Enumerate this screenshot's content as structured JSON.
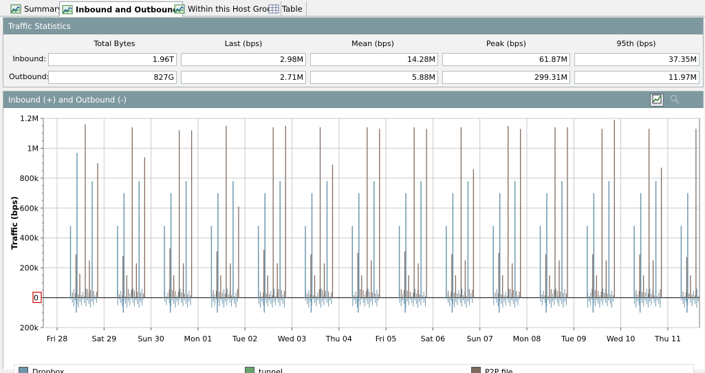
{
  "tabs": [
    {
      "label": "Summary",
      "active": false,
      "icon": "chart-icon"
    },
    {
      "label": "Inbound and Outbound",
      "active": true,
      "icon": "chart-icon"
    },
    {
      "label": "Within this Host Group",
      "active": false,
      "icon": "chart-icon"
    },
    {
      "label": "Table",
      "active": false,
      "icon": "table-icon"
    }
  ],
  "stats": {
    "title": "Traffic Statistics",
    "columns": [
      "Total Bytes",
      "Last (bps)",
      "Mean (bps)",
      "Peak (bps)",
      "95th (bps)"
    ],
    "rows": [
      {
        "label": "Inbound:",
        "values": [
          "1.96T",
          "2.98M",
          "14.28M",
          "61.87M",
          "37.35M"
        ]
      },
      {
        "label": "Outbound:",
        "values": [
          "827G",
          "2.71M",
          "5.88M",
          "299.31M",
          "11.97M"
        ]
      }
    ]
  },
  "chart_panel": {
    "title": "Inbound (+) and Outbound (-)",
    "buttons": [
      "chart-options-icon",
      "zoom-icon"
    ]
  },
  "chart_data": {
    "type": "bar",
    "ylabel": "Traffic (bps)",
    "ylim": [
      -200000,
      1200000
    ],
    "yticks": [
      "1.2M",
      "1M",
      "800k",
      "600k",
      "400k",
      "200k",
      "0",
      "200k"
    ],
    "yticks_values": [
      1200000,
      1000000,
      800000,
      600000,
      400000,
      200000,
      0,
      -200000
    ],
    "xticks": [
      "Fri 28",
      "Sat 29",
      "Sun 30",
      "Mon 01",
      "Tue 02",
      "Wed 03",
      "Thu 04",
      "Fri 05",
      "Sat 06",
      "Sun 07",
      "Mon 08",
      "Tue 09",
      "Wed 10",
      "Thu 11"
    ],
    "grid": true,
    "legend_position": "bottom",
    "series": [
      {
        "name": "Dropbox",
        "color": "#6d97ae",
        "days": [
          [
            0.48,
            -0.1,
            0.97,
            0.06,
            0.78
          ],
          [
            0.48,
            -0.1,
            0.7,
            0.06,
            0.78
          ],
          [
            0.48,
            -0.1,
            0.7,
            0.06,
            0.78
          ],
          [
            0.48,
            -0.1,
            0.7,
            0.06,
            0.78
          ],
          [
            0.48,
            -0.1,
            0.7,
            0.06,
            0.78
          ],
          [
            0.48,
            -0.1,
            0.7,
            0.06,
            0.78
          ],
          [
            0.48,
            -0.1,
            0.7,
            0.06,
            0.78
          ],
          [
            0.48,
            -0.1,
            0.7,
            0.06,
            0.78
          ],
          [
            0.48,
            -0.1,
            0.7,
            0.06,
            0.78
          ],
          [
            0.48,
            -0.1,
            0.7,
            0.06,
            0.78
          ],
          [
            0.48,
            -0.1,
            0.7,
            0.06,
            0.78
          ],
          [
            0.48,
            -0.1,
            0.7,
            0.06,
            0.78
          ],
          [
            0.48,
            -0.1,
            0.7,
            0.06,
            0.78
          ],
          [
            0.48,
            -0.1,
            0.7,
            0.06,
            0.78
          ]
        ]
      },
      {
        "name": "tunnel",
        "color": "#6aa36e",
        "days": []
      },
      {
        "name": "P2P file",
        "color": "#7f6b5f",
        "days": [
          [
            0.29,
            0.16,
            1.16,
            0.25,
            0.9
          ],
          [
            0.28,
            0.15,
            1.14,
            0.23,
            0.94
          ],
          [
            0.33,
            0.15,
            1.12,
            0.23,
            1.12
          ],
          [
            0.31,
            0.15,
            1.15,
            0.23,
            0.61
          ],
          [
            0.32,
            0.15,
            1.14,
            0.23,
            1.15
          ],
          [
            0.29,
            0.15,
            1.14,
            0.23,
            0.89
          ],
          [
            0.3,
            0.15,
            1.14,
            0.25,
            1.13
          ],
          [
            0.31,
            0.15,
            1.14,
            0.23,
            1.13
          ],
          [
            0.29,
            0.15,
            1.14,
            0.25,
            0.86
          ],
          [
            0.3,
            0.15,
            1.15,
            0.23,
            1.13
          ],
          [
            0.29,
            0.15,
            1.14,
            0.25,
            1.14
          ],
          [
            0.29,
            0.15,
            1.13,
            0.25,
            1.19
          ],
          [
            0.29,
            0.15,
            1.13,
            0.25,
            0.87
          ],
          [
            0.27,
            0.15,
            1.13,
            0.25,
            1.05
          ]
        ]
      }
    ]
  }
}
